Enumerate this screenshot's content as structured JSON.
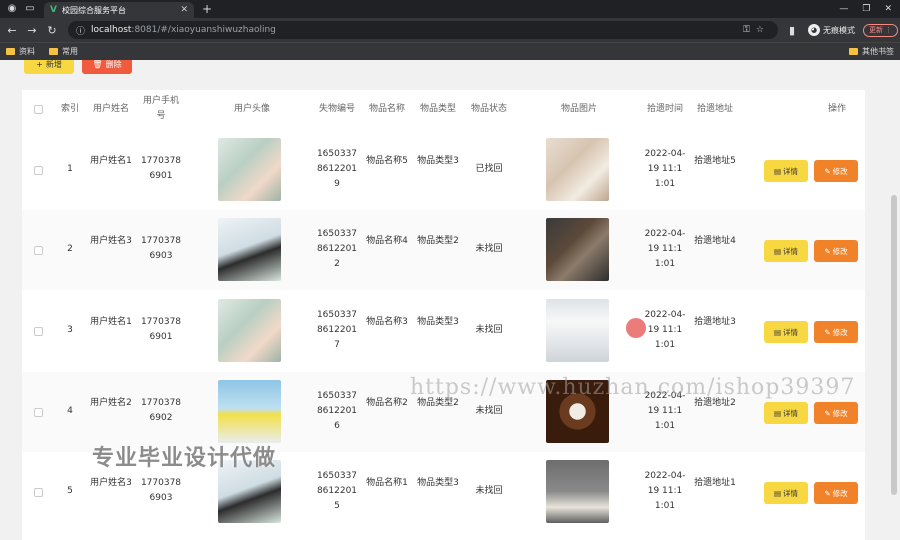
{
  "browser": {
    "tab_title": "校园综合服务平台",
    "url_host": "localhost",
    "url_path": ":8081/#/xiaoyuanshiwuzhaoling",
    "profile_label": "无痕模式",
    "update_label": "更新",
    "bookmarks": [
      "资料",
      "常用"
    ],
    "other_bookmarks": "其他书签"
  },
  "toolbar": {
    "add_label": "新增",
    "delete_label": "删除"
  },
  "table": {
    "headers": {
      "index": "索引",
      "username": "用户姓名",
      "phone": "用户手机号",
      "avatar": "用户头像",
      "lost_no": "失物编号",
      "item_name": "物品名称",
      "item_type": "物品类型",
      "item_status": "物品状态",
      "item_pic": "物品图片",
      "pickup_time": "拾遗时间",
      "pickup_place": "拾遗地址",
      "actions": "操作"
    },
    "rows": [
      {
        "index": "1",
        "username": "用户姓名1",
        "phone": "17703786901",
        "lost_no": "16503378612201 9",
        "item_name": "物品名称5",
        "item_type": "物品类型3",
        "status": "已找回",
        "time": "2022-04-19 11:11:01",
        "place": "拾遗地址5"
      },
      {
        "index": "2",
        "username": "用户姓名3",
        "phone": "17703786903",
        "lost_no": "16503378612201 2",
        "item_name": "物品名称4",
        "item_type": "物品类型2",
        "status": "未找回",
        "time": "2022-04-19 11:11:01",
        "place": "拾遗地址4"
      },
      {
        "index": "3",
        "username": "用户姓名1",
        "phone": "17703786901",
        "lost_no": "16503378612201 7",
        "item_name": "物品名称3",
        "item_type": "物品类型3",
        "status": "未找回",
        "time": "2022-04-19 11:11:01",
        "place": "拾遗地址3"
      },
      {
        "index": "4",
        "username": "用户姓名2",
        "phone": "17703786902",
        "lost_no": "16503378612201 6",
        "item_name": "物品名称2",
        "item_type": "物品类型2",
        "status": "未找回",
        "time": "2022-04-19 11:11:01",
        "place": "拾遗地址2"
      },
      {
        "index": "5",
        "username": "用户姓名3",
        "phone": "17703786903",
        "lost_no": "16503378612201 5",
        "item_name": "物品名称1",
        "item_type": "物品类型3",
        "status": "未找回",
        "time": "2022-04-19 11:11:01",
        "place": "拾遗地址1"
      }
    ],
    "detail_label": "详情",
    "edit_label": "修改"
  },
  "watermarks": {
    "url": "https://www.huzhan.com/ishop39397",
    "cn": "专业毕业设计代做"
  }
}
